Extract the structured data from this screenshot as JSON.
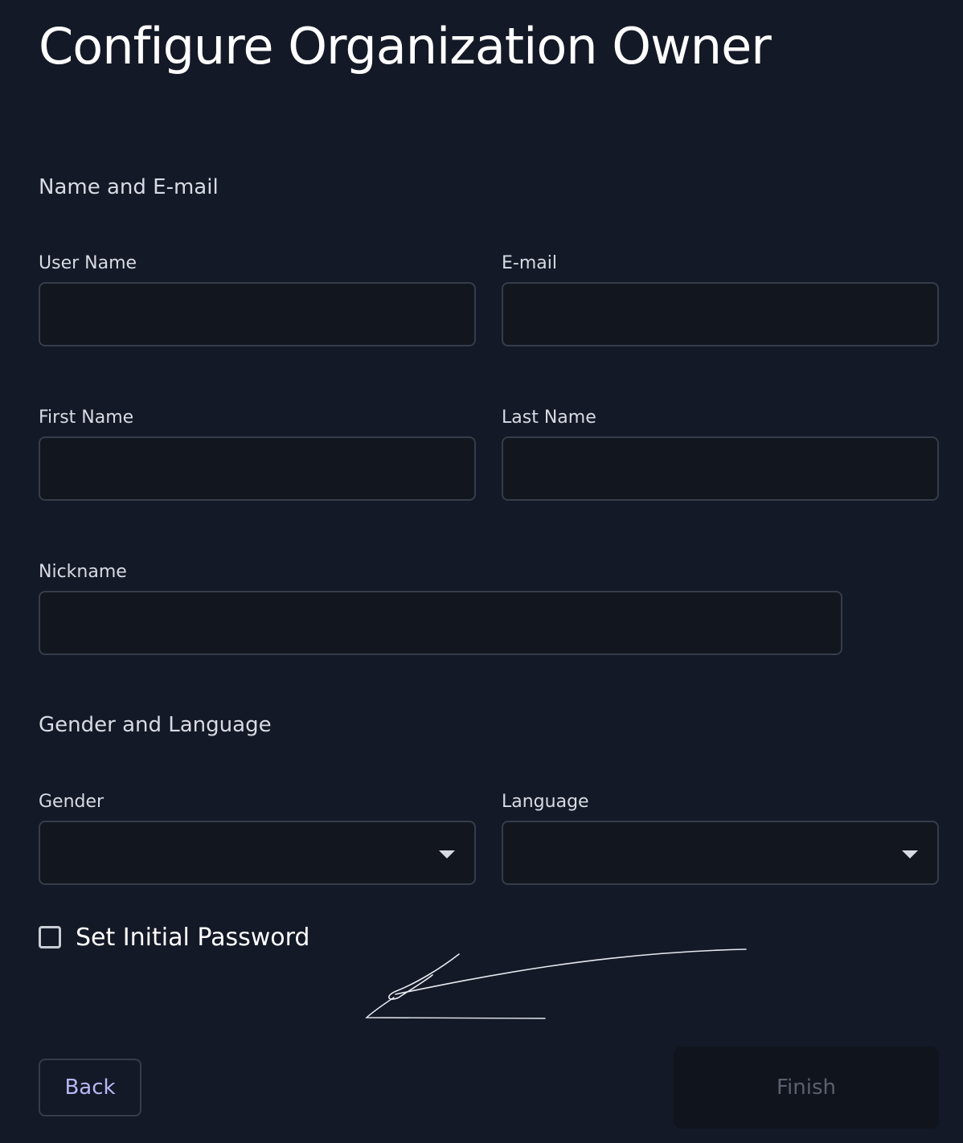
{
  "page": {
    "title": "Configure Organization Owner"
  },
  "sections": {
    "name_email": "Name and E-mail",
    "gender_language": "Gender and Language"
  },
  "fields": {
    "user_name": {
      "label": "User Name",
      "value": ""
    },
    "email": {
      "label": "E-mail",
      "value": ""
    },
    "first_name": {
      "label": "First Name",
      "value": ""
    },
    "last_name": {
      "label": "Last Name",
      "value": ""
    },
    "nickname": {
      "label": "Nickname",
      "value": ""
    },
    "gender": {
      "label": "Gender",
      "value": ""
    },
    "language": {
      "label": "Language",
      "value": ""
    }
  },
  "checkbox": {
    "label": "Set Initial Password",
    "checked": false
  },
  "buttons": {
    "back": "Back",
    "finish": "Finish"
  },
  "colors": {
    "background": "#141927",
    "input_background": "#12161f",
    "border": "#363c4a",
    "accent": "#b8b7f5",
    "disabled_text": "#5b606c"
  },
  "icons": {
    "select_caret": "chevron-down-icon"
  }
}
